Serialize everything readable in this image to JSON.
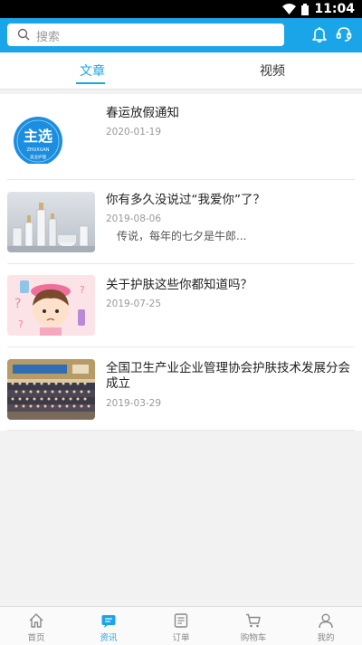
{
  "status_bar": {
    "time": "11:04"
  },
  "search": {
    "placeholder": "搜索"
  },
  "tabs": [
    {
      "label": "文章",
      "active": true
    },
    {
      "label": "视频",
      "active": false
    }
  ],
  "articles": [
    {
      "title": "春运放假通知",
      "date": "2020-01-19",
      "summary": "",
      "thumb": "zhuxuan-logo",
      "logo_text": "主选",
      "logo_sub": "ZHUXUAN",
      "logo_foot": "美业护理"
    },
    {
      "title": "你有多久没说过“我爱你”了？",
      "date": "2019-08-06",
      "summary": "传说，每年的七夕是牛郎...",
      "thumb": "cosmetics-bottles"
    },
    {
      "title": "关于护肤这些你都知道吗？",
      "date": "2019-07-25",
      "summary": "",
      "thumb": "skincare-cartoon-girl"
    },
    {
      "title": "全国卫生产业企业管理协会护肤技术发展分会成立",
      "date": "2019-03-29",
      "summary": "",
      "thumb": "group-photo"
    }
  ],
  "bottom_nav": [
    {
      "label": "首页",
      "icon": "home-icon",
      "active": false
    },
    {
      "label": "资讯",
      "icon": "news-icon",
      "active": true
    },
    {
      "label": "订单",
      "icon": "order-icon",
      "active": false
    },
    {
      "label": "购物车",
      "icon": "cart-icon",
      "active": false
    },
    {
      "label": "我的",
      "icon": "user-icon",
      "active": false
    }
  ],
  "colors": {
    "accent": "#1aa5e8",
    "header": "#1aa5e8"
  }
}
